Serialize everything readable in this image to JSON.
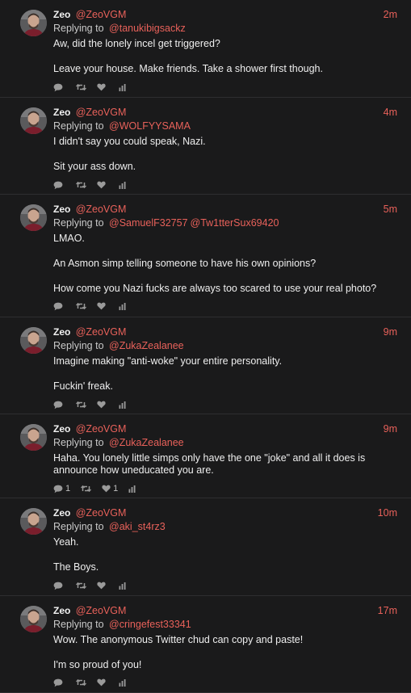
{
  "tweets": [
    {
      "name": "Zeo",
      "handle": "@ZeoVGM",
      "time": "2m",
      "replying_label": "Replying to",
      "replying_to": [
        "@tanukibigsackz"
      ],
      "paragraphs": [
        "Aw, did the lonely incel get triggered?",
        "Leave your house. Make friends. Take a shower first though."
      ],
      "reply_count": "",
      "like_count": ""
    },
    {
      "name": "Zeo",
      "handle": "@ZeoVGM",
      "time": "4m",
      "replying_label": "Replying to",
      "replying_to": [
        "@WOLFYYSAMA"
      ],
      "paragraphs": [
        "I didn't say you could speak, Nazi.",
        "Sit your ass down."
      ],
      "reply_count": "",
      "like_count": ""
    },
    {
      "name": "Zeo",
      "handle": "@ZeoVGM",
      "time": "5m",
      "replying_label": "Replying to",
      "replying_to": [
        "@SamuelF32757",
        "@Tw1tterSux69420"
      ],
      "paragraphs": [
        "LMAO.",
        "An Asmon simp telling someone to have his own opinions?",
        "How come you Nazi fucks are always too scared to use your real photo?"
      ],
      "reply_count": "",
      "like_count": ""
    },
    {
      "name": "Zeo",
      "handle": "@ZeoVGM",
      "time": "9m",
      "replying_label": "Replying to",
      "replying_to": [
        "@ZukaZealanee"
      ],
      "paragraphs": [
        "Imagine making \"anti-woke\" your entire personality.",
        "Fuckin' freak."
      ],
      "reply_count": "",
      "like_count": ""
    },
    {
      "name": "Zeo",
      "handle": "@ZeoVGM",
      "time": "9m",
      "replying_label": "Replying to",
      "replying_to": [
        "@ZukaZealanee"
      ],
      "paragraphs": [
        "Haha. You lonely little simps only have the one \"joke\" and all it does is announce how uneducated you are."
      ],
      "reply_count": "1",
      "like_count": "1"
    },
    {
      "name": "Zeo",
      "handle": "@ZeoVGM",
      "time": "10m",
      "replying_label": "Replying to",
      "replying_to": [
        "@aki_st4rz3"
      ],
      "paragraphs": [
        "Yeah.",
        "The Boys."
      ],
      "reply_count": "",
      "like_count": ""
    },
    {
      "name": "Zeo",
      "handle": "@ZeoVGM",
      "time": "17m",
      "replying_label": "Replying to",
      "replying_to": [
        "@cringefest33341"
      ],
      "paragraphs": [
        "Wow. The anonymous Twitter chud can copy and paste!",
        "I'm so proud of you!"
      ],
      "reply_count": "",
      "like_count": ""
    }
  ],
  "icons": {
    "reply": "reply-icon",
    "retweet": "retweet-icon",
    "like": "heart-icon",
    "analytics": "analytics-icon"
  },
  "colors": {
    "background": "#1a1a1b",
    "accent": "#e8615a",
    "text": "#eeeeee",
    "muted": "#9a9a9a",
    "divider": "#2e2e30"
  }
}
